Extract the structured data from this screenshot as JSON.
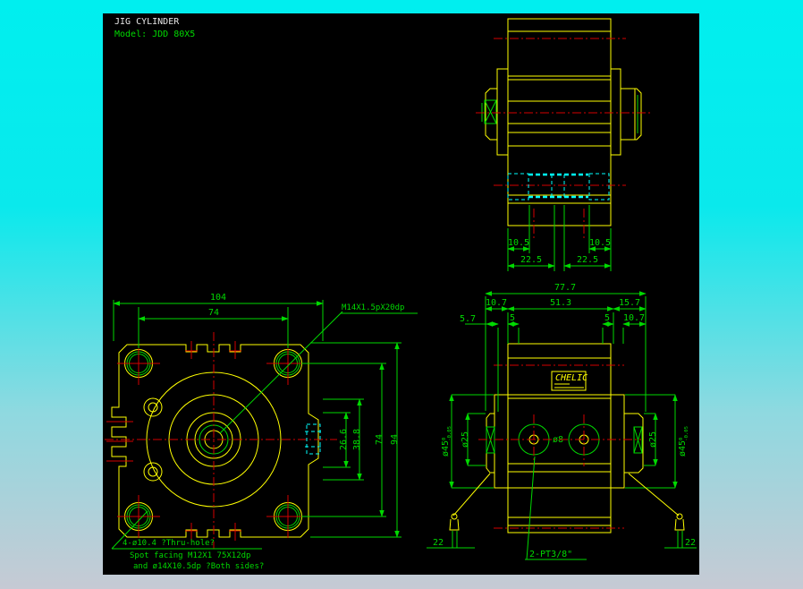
{
  "header": {
    "title": "JIG CYLINDER",
    "model": "Model: JDD 80X5"
  },
  "colors": {
    "outline": "#ffff00",
    "dimension": "#00d900",
    "centerline": "#d40000",
    "hidden": "#00ffff",
    "title_text": "#e6e6e6",
    "frame_top": "#00efef",
    "frame_bottom": "#c6cad4",
    "canvas": "#000000"
  },
  "top_view": {
    "dim_10_5_left": "10.5",
    "dim_10_5_right": "10.5",
    "dim_22_5_left": "22.5",
    "dim_22_5_right": "22.5"
  },
  "front_view": {
    "dim_width_outer": "104",
    "dim_width_bolt": "74",
    "thread_label": "M14X1.5pX20dp",
    "dim_26_6": "26.6",
    "dim_38_8": "38.8",
    "dim_74_vertical": "74",
    "dim_94": "94",
    "note_line1": "4-ø10.4 ?Thru-hole?",
    "note_line2": "Spot facing M12X1 75X12dp",
    "note_line3": "and ø14X10.5dp ?Both sides?"
  },
  "side_view": {
    "dim_77_7": "77.7",
    "dim_10_7_left": "10.7",
    "dim_51_3": "51.3",
    "dim_15_7": "15.7",
    "dim_5_7": "5.7",
    "dim_5_left": "5",
    "dim_5_right": "5",
    "dim_10_7_right": "10.7",
    "dia_45": "ø45",
    "tol_top": "0",
    "tol_bottom": "-0.05",
    "dia_25": "ø25",
    "port_dia": "ø8",
    "logo": "CHELIC",
    "dim_22_left": "22",
    "dim_22_right": "22",
    "port_label": "2-PT3/8\""
  }
}
